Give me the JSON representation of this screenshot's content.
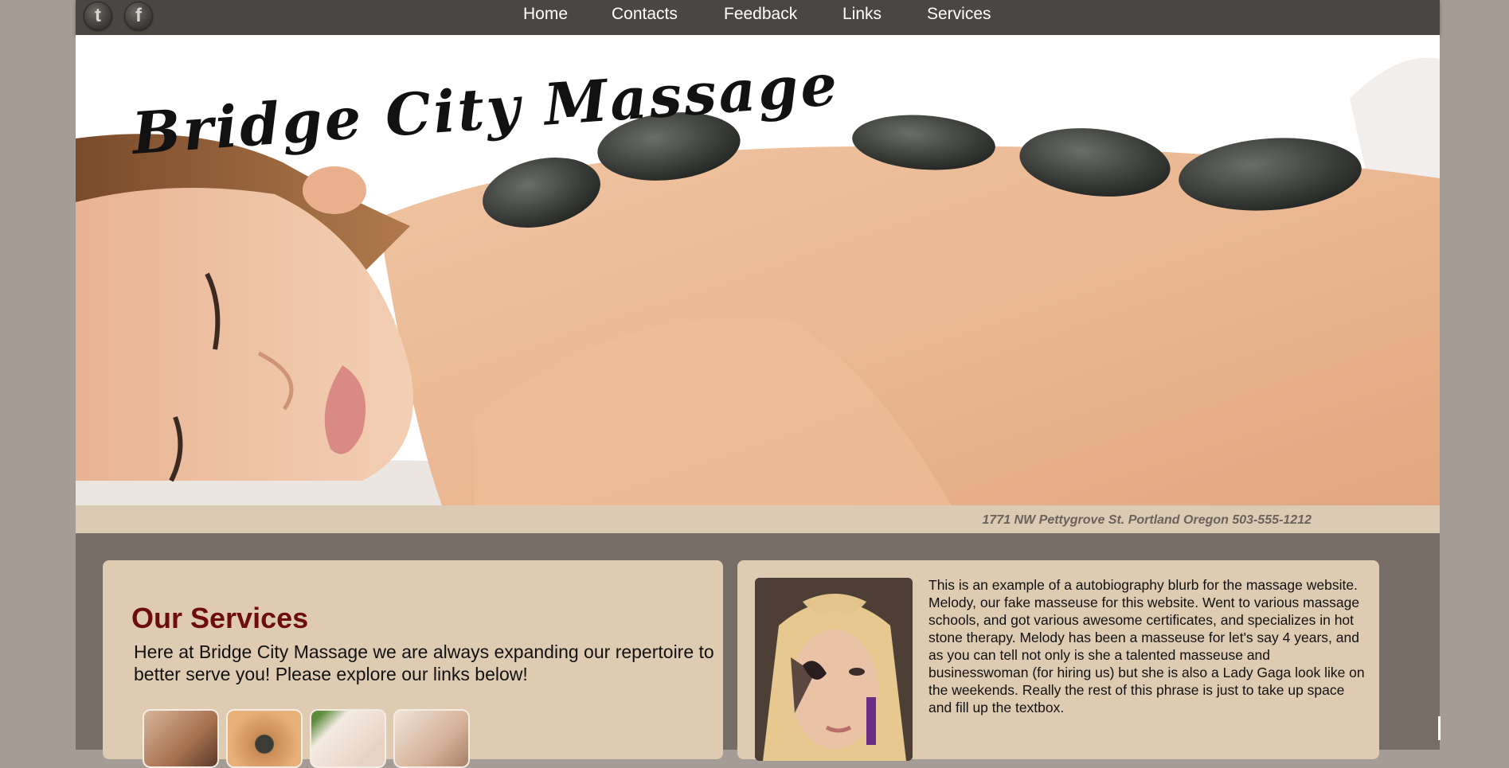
{
  "social": {
    "tumblr_letter": "t",
    "facebook_letter": "f"
  },
  "nav": {
    "items": [
      {
        "label": "Home"
      },
      {
        "label": "Contacts"
      },
      {
        "label": "Feedback"
      },
      {
        "label": "Links"
      },
      {
        "label": "Services"
      }
    ]
  },
  "hero": {
    "brand": "Bridge City Massage"
  },
  "address": {
    "text": "1771 NW Pettygrove St. Portland Oregon 503-555-1212"
  },
  "services": {
    "title": "Our Services",
    "intro": "Here at Bridge City Massage we are always expanding our repertoire to better serve you! Please explore our links below!"
  },
  "bio": {
    "text": "This is an example of a autobiography blurb for the massage website. Melody, our fake masseuse for this website. Went to various massage schools, and got various awesome certificates, and specializes in hot stone therapy. Melody has been a masseuse for let's say 4 years, and as you can tell not only is she a talented masseuse and businesswoman (for hiring us) but she is also a Lady Gaga look like on the weekends. Really the rest of this phrase is just to take up space and fill up the textbox."
  },
  "colors": {
    "nav_bar": "#4a4643",
    "page_bg": "#a59d95",
    "panel_bg": "#dfcbb2",
    "title_red": "#6e0d0d",
    "content_bg": "#776d67"
  }
}
